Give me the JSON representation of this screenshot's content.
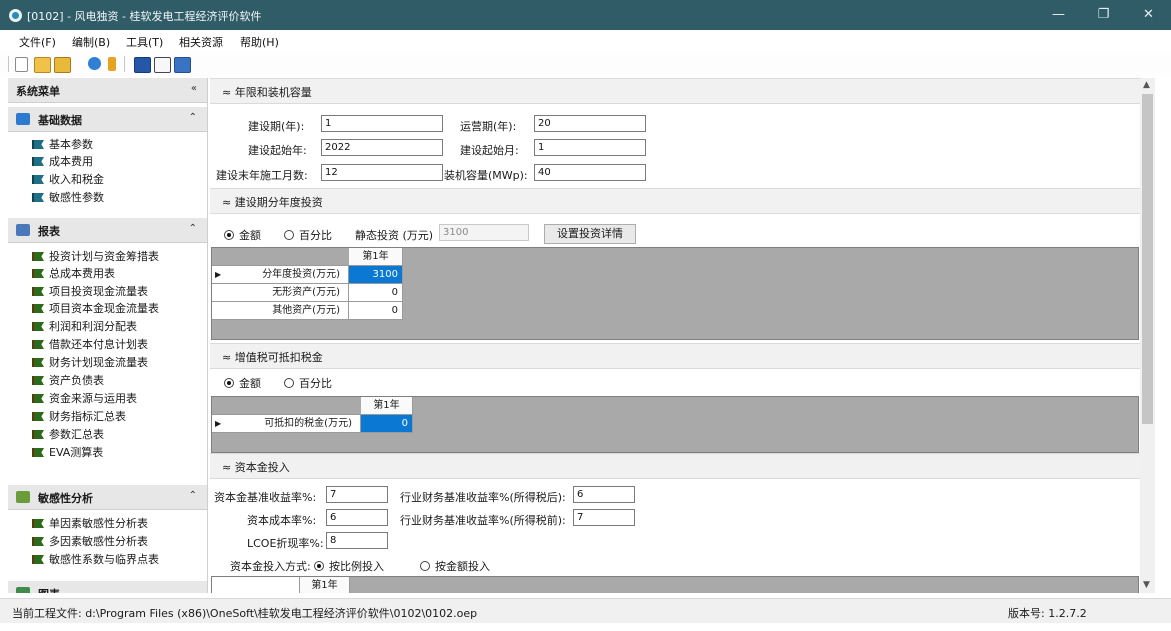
{
  "window": {
    "title": "[0102] - 风电独资 - 桂软发电工程经济评价软件",
    "minimize_glyph": "—",
    "restore_glyph": "❐",
    "close_glyph": "✕"
  },
  "menu": [
    "文件(F)",
    "编制(B)",
    "工具(T)",
    "相关资源",
    "帮助(H)"
  ],
  "toolbar_icons": [
    "new-icon",
    "open-icon",
    "open-dropdown-icon",
    "help-icon",
    "info-icon",
    "save-icon",
    "sum-icon",
    "export-icon"
  ],
  "sidebar": {
    "title": "系统菜单",
    "collapse_glyph": "«",
    "sections": [
      {
        "title": "基础数据",
        "chevron": "⌃",
        "items": [
          "基本参数",
          "成本费用",
          "收入和税金",
          "敏感性参数"
        ]
      },
      {
        "title": "报表",
        "chevron": "⌃",
        "items": [
          "投资计划与资金筹措表",
          "总成本费用表",
          "项目投资现金流量表",
          "项目资本金现金流量表",
          "利润和利润分配表",
          "借款还本付息计划表",
          "财务计划现金流量表",
          "资产负债表",
          "资金来源与运用表",
          "财务指标汇总表",
          "参数汇总表",
          "EVA测算表"
        ]
      },
      {
        "title": "敏感性分析",
        "chevron": "⌃",
        "items": [
          "单因素敏感性分析表",
          "多因素敏感性分析表",
          "敏感性系数与临界点表"
        ]
      },
      {
        "title": "图表"
      }
    ]
  },
  "content": {
    "section_glyph": "≈",
    "sec1": {
      "title": "年限和装机容量",
      "fields": {
        "build_years": {
          "label": "建设期(年):",
          "value": "1"
        },
        "operation_years": {
          "label": "运营期(年):",
          "value": "20"
        },
        "build_start_year": {
          "label": "建设起始年:",
          "value": "2022"
        },
        "build_start_month": {
          "label": "建设起始月:",
          "value": "1"
        },
        "last_year_months": {
          "label": "建设末年施工月数:",
          "value": "12"
        },
        "capacity": {
          "label": "装机容量(MWp):",
          "value": "40"
        }
      }
    },
    "sec2": {
      "title": "建设期分年度投资",
      "radio_amount": "金额",
      "radio_percent": "百分比",
      "static_label": "静态投资 (万元)",
      "static_value": "3100",
      "detail_button": "设置投资详情",
      "grid": {
        "header": "第1年",
        "rows": [
          {
            "label": "分年度投资(万元)",
            "value": "3100"
          },
          {
            "label": "无形资产(万元)",
            "value": "0"
          },
          {
            "label": "其他资产(万元)",
            "value": "0"
          }
        ]
      }
    },
    "sec3": {
      "title": "增值税可抵扣税金",
      "radio_amount": "金额",
      "radio_percent": "百分比",
      "grid": {
        "header": "第1年",
        "rows": [
          {
            "label": "可抵扣的税金(万元)",
            "value": "0"
          }
        ]
      }
    },
    "sec4": {
      "title": "资本金投入",
      "fields": {
        "equity_rate": {
          "label": "资本金基准收益率%:",
          "value": "7"
        },
        "industry_after_tax": {
          "label": "行业财务基准收益率%(所得税后):",
          "value": "6"
        },
        "capital_cost": {
          "label": "资本成本率%:",
          "value": "6"
        },
        "industry_before_tax": {
          "label": "行业财务基准收益率%(所得税前):",
          "value": "7"
        },
        "lcoe_discount": {
          "label": "LCOE折现率%:",
          "value": "8"
        }
      },
      "input_mode_label": "资本金投入方式:",
      "radio_ratio": "按比例投入",
      "radio_amount": "按金额投入",
      "grid_header": "第1年"
    }
  },
  "status": {
    "file": "当前工程文件: d:\\Program Files (x86)\\OneSoft\\桂软发电工程经济评价软件\\0102\\0102.oep",
    "version": "版本号: 1.2.7.2"
  }
}
